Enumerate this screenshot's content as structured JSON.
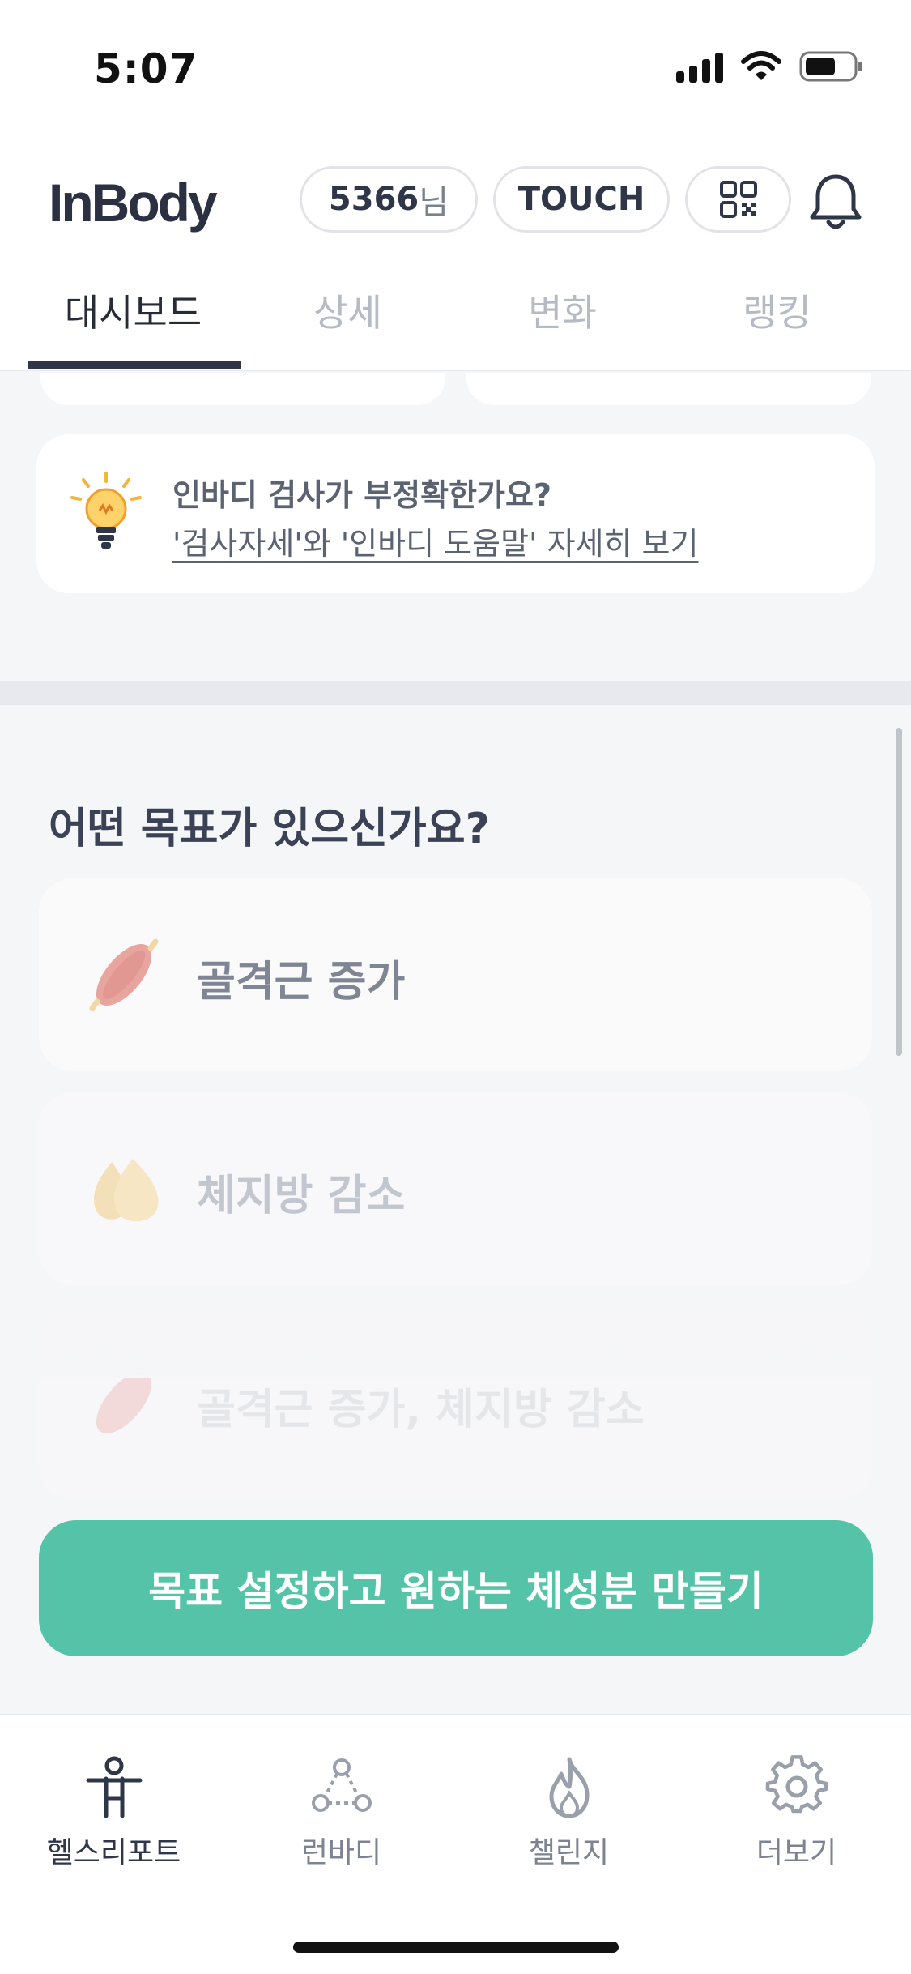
{
  "status_bar": {
    "time": "5:07"
  },
  "header": {
    "logo": "InBody",
    "user_id": "5366",
    "user_suffix": "님",
    "touch_label": "TOUCH"
  },
  "tabs": [
    {
      "label": "대시보드",
      "active": true
    },
    {
      "label": "상세",
      "active": false
    },
    {
      "label": "변화",
      "active": false
    },
    {
      "label": "랭킹",
      "active": false
    }
  ],
  "help_card": {
    "title": "인바디 검사가 부정확한가요?",
    "link": "'검사자세'와 '인바디 도움말' 자세히 보기"
  },
  "goal_section": {
    "heading": "어떤 목표가 있으신가요?",
    "options": [
      {
        "label": "골격근 증가",
        "icon": "muscle-icon"
      },
      {
        "label": "체지방 감소",
        "icon": "fat-drops-icon"
      },
      {
        "label": "골격근 증가, 체지방 감소",
        "icon": "muscle-icon"
      }
    ],
    "cta": "목표 설정하고 원하는 체성분 만들기"
  },
  "bottom_nav": [
    {
      "label": "헬스리포트",
      "icon": "body-icon",
      "active": true
    },
    {
      "label": "런바디",
      "icon": "network-icon",
      "active": false
    },
    {
      "label": "챌린지",
      "icon": "flame-icon",
      "active": false
    },
    {
      "label": "더보기",
      "icon": "gear-icon",
      "active": false
    }
  ],
  "colors": {
    "accent": "#55c3a7",
    "text_dark": "#2f3648",
    "tab_inactive": "#b6bac4",
    "background": "#f5f6f8"
  }
}
